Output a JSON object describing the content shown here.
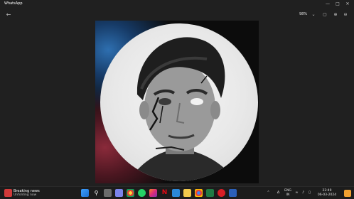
{
  "window": {
    "title": "WhatsApp",
    "minimize_icon": "minimize-icon",
    "maximize_icon": "maximize-icon",
    "close_icon": "close-icon"
  },
  "toolbar": {
    "back_icon": "back-arrow-icon",
    "zoom_level": "98%",
    "zoom_dropdown_icon": "chevron-down-icon",
    "icons": [
      "fit-screen-icon",
      "zoom-in-icon",
      "zoom-out-icon"
    ]
  },
  "photo": {
    "description_icon": "profile-photo"
  },
  "taskbar": {
    "news": {
      "title": "Breaking news",
      "subtitle": "Unfolding now"
    },
    "apps": [
      "start",
      "search",
      "task-view",
      "teams",
      "chrome",
      "whatsapp",
      "instagram",
      "netflix",
      "microsoft-store",
      "file-explorer",
      "google-chrome",
      "excel",
      "opera",
      "word"
    ],
    "tray": {
      "language_top": "ENG",
      "language_bottom": "IN",
      "time": "22:49",
      "date": "06-03-2024"
    }
  }
}
